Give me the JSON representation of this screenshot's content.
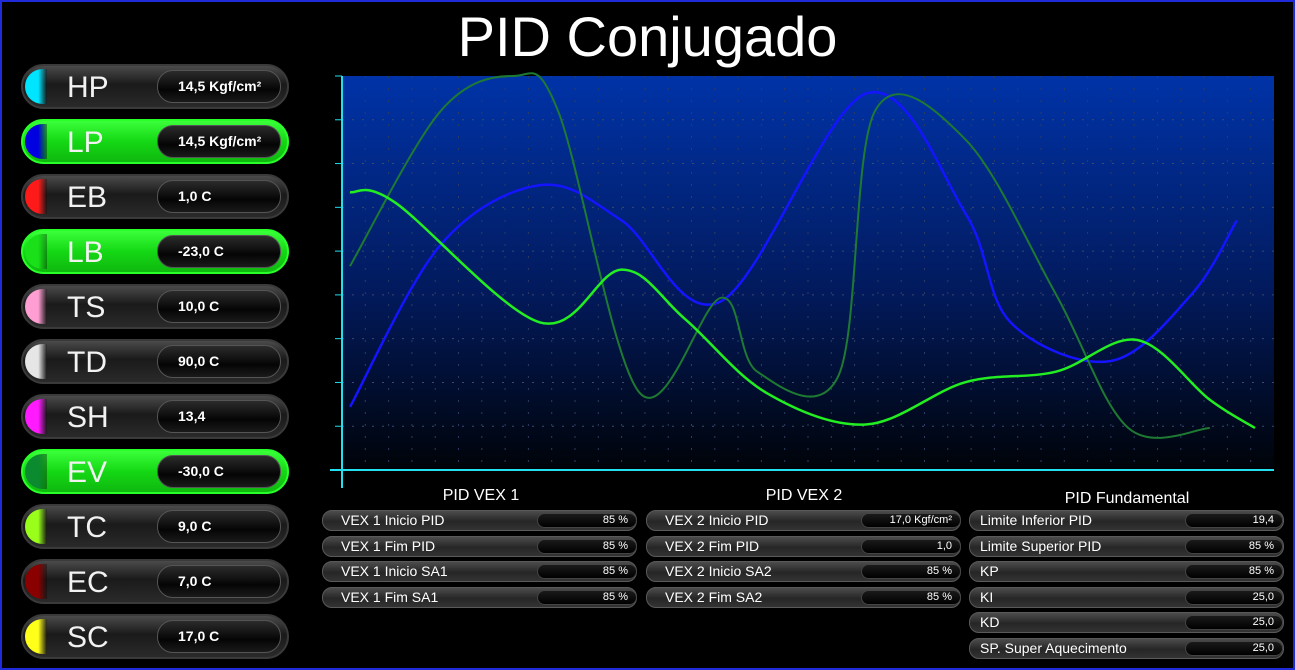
{
  "title": "PID Conjugado",
  "sensors": [
    {
      "tag": "HP",
      "value": "14,5 Kgf/cm²",
      "color": "#00e5ff",
      "active": false
    },
    {
      "tag": "LP",
      "value": "14,5 Kgf/cm²",
      "color": "#0000e0",
      "active": true
    },
    {
      "tag": "EB",
      "value": "1,0 C",
      "color": "#ff1a1a",
      "active": false
    },
    {
      "tag": "LB",
      "value": "-23,0 C",
      "color": "#19e019",
      "active": true
    },
    {
      "tag": "TS",
      "value": "10,0 C",
      "color": "#ff9ed2",
      "active": false
    },
    {
      "tag": "TD",
      "value": "90,0 C",
      "color": "#e6e6e6",
      "active": false
    },
    {
      "tag": "SH",
      "value": "13,4",
      "color": "#ff1aff",
      "active": false
    },
    {
      "tag": "EV",
      "value": "-30,0 C",
      "color": "#0c8a30",
      "active": true
    },
    {
      "tag": "TC",
      "value": "9,0 C",
      "color": "#99ff1a",
      "active": false
    },
    {
      "tag": "EC",
      "value": "7,0 C",
      "color": "#8a0000",
      "active": false
    },
    {
      "tag": "SC",
      "value": "17,0 C",
      "color": "#ffff1a",
      "active": false
    }
  ],
  "chart_data": {
    "type": "line",
    "title": "",
    "xlabel": "",
    "ylabel": "",
    "xlim": [
      0,
      100
    ],
    "ylim": [
      0,
      100
    ],
    "grid": true,
    "series": [
      {
        "color": "#1414ff",
        "x": [
          0,
          10,
          21,
          30,
          41,
          57,
          68,
          73,
          84,
          93,
          98
        ],
        "y": [
          6,
          52,
          69,
          59,
          36,
          95,
          61,
          30,
          19,
          38,
          59
        ]
      },
      {
        "color": "#1e7a32",
        "x": [
          0,
          10,
          18,
          23,
          32,
          41,
          45,
          54,
          58,
          68,
          78,
          86,
          95
        ],
        "y": [
          46,
          90,
          100,
          90,
          10,
          37,
          16,
          15,
          90,
          82,
          38,
          0,
          0
        ]
      },
      {
        "color": "#22ee22",
        "x": [
          0,
          5,
          21,
          30,
          37,
          46,
          57,
          68,
          78,
          87,
          95,
          100
        ],
        "y": [
          67,
          64,
          30,
          45,
          31,
          10,
          1,
          13,
          16,
          25,
          8,
          0
        ]
      }
    ]
  },
  "panels": [
    {
      "title": "PID VEX 1",
      "rows": [
        {
          "label": "VEX 1 Inicio PID",
          "value": "85 %"
        },
        {
          "label": "VEX 1 Fim PID",
          "value": "85 %"
        },
        {
          "label": "VEX 1 Inicio SA1",
          "value": "85 %"
        },
        {
          "label": "VEX 1 Fim SA1",
          "value": "85 %"
        }
      ]
    },
    {
      "title": "PID VEX 2",
      "rows": [
        {
          "label": "VEX 2 Inicio PID",
          "value": "17,0 Kgf/cm²"
        },
        {
          "label": "VEX 2 Fim PID",
          "value": "1,0"
        },
        {
          "label": "VEX 2 Inicio SA2",
          "value": "85 %"
        },
        {
          "label": "VEX 2 Fim SA2",
          "value": "85 %"
        }
      ]
    },
    {
      "title": "PID Fundamental",
      "rows": [
        {
          "label": "Limite Inferior PID",
          "value": "19,4"
        },
        {
          "label": "Limite Superior PID",
          "value": "85 %"
        },
        {
          "label": "KP",
          "value": "85 %"
        },
        {
          "label": "KI",
          "value": "25,0"
        },
        {
          "label": "KD",
          "value": "25,0"
        },
        {
          "label": "SP. Super Aquecimento",
          "value": "25,0"
        }
      ]
    }
  ]
}
